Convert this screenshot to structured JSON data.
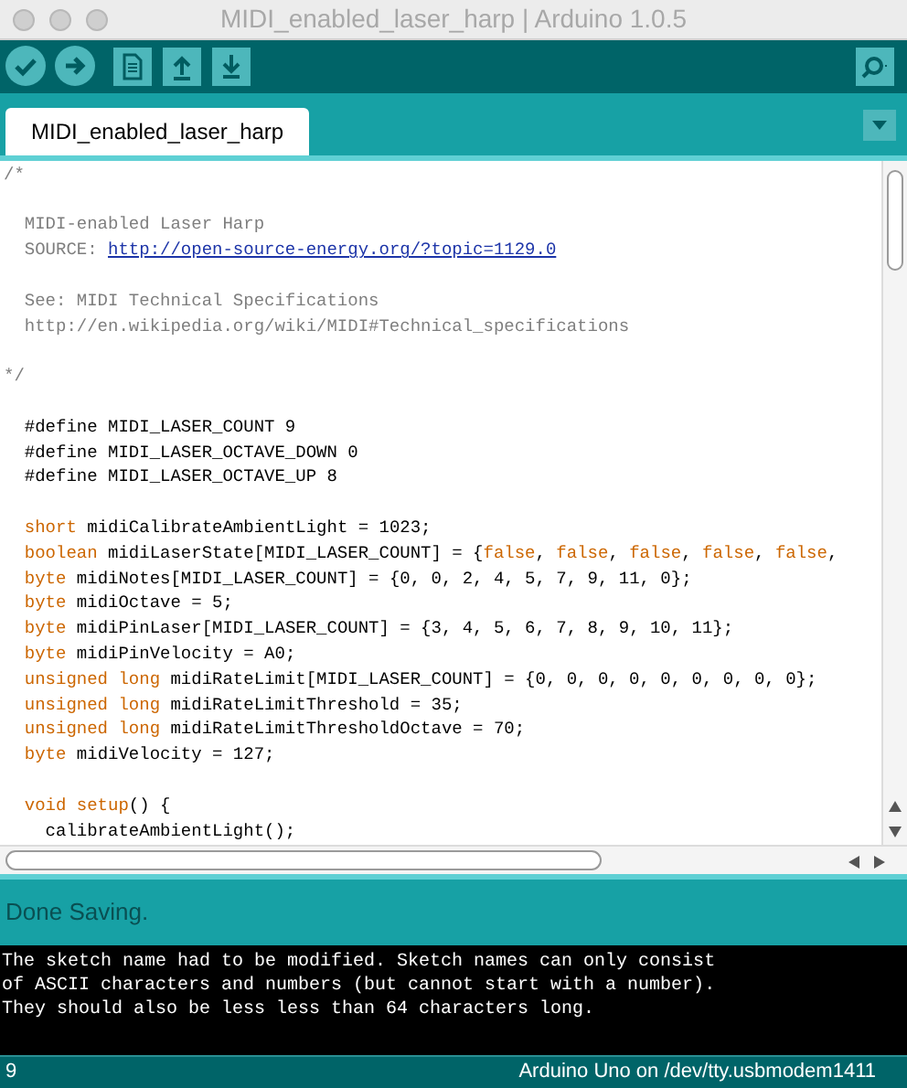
{
  "window": {
    "title": "MIDI_enabled_laser_harp | Arduino 1.0.5"
  },
  "tabs": [
    {
      "label": "MIDI_enabled_laser_harp",
      "selected": true
    }
  ],
  "editor": {
    "blocks": [
      {
        "lines": [
          [
            {
              "text": "/*",
              "kind": "comment"
            }
          ]
        ]
      },
      {
        "lines": [
          [
            {
              "text": "  MIDI-enabled Laser Harp",
              "kind": "comment"
            }
          ],
          [
            {
              "text": "  SOURCE: ",
              "kind": "comment"
            },
            {
              "text": "http://open-source-energy.org/?topic=1129.0",
              "kind": "link"
            }
          ]
        ]
      },
      {
        "lines": [
          [
            {
              "text": "  See: MIDI Technical Specifications",
              "kind": "comment"
            }
          ],
          [
            {
              "text": "  http://en.wikipedia.org/wiki/MIDI#Technical_specifications",
              "kind": "comment"
            }
          ]
        ]
      },
      {
        "lines": [
          [
            {
              "text": "*/",
              "kind": "comment"
            }
          ]
        ]
      },
      {
        "lines": [
          [
            {
              "text": "  #define MIDI_LASER_COUNT 9",
              "kind": "plain"
            }
          ],
          [
            {
              "text": "  #define MIDI_LASER_OCTAVE_DOWN 0",
              "kind": "plain"
            }
          ],
          [
            {
              "text": "  #define MIDI_LASER_OCTAVE_UP 8",
              "kind": "plain"
            }
          ]
        ]
      },
      {
        "lines": [
          [
            {
              "text": "  short",
              "kind": "keyword"
            },
            {
              "text": " midiCalibrateAmbientLight = 1023;",
              "kind": "plain"
            }
          ],
          [
            {
              "text": "  boolean",
              "kind": "keyword"
            },
            {
              "text": " midiLaserState[MIDI_LASER_COUNT] = {",
              "kind": "plain"
            },
            {
              "text": "false",
              "kind": "keyword"
            },
            {
              "text": ", ",
              "kind": "plain"
            },
            {
              "text": "false",
              "kind": "keyword"
            },
            {
              "text": ", ",
              "kind": "plain"
            },
            {
              "text": "false",
              "kind": "keyword"
            },
            {
              "text": ", ",
              "kind": "plain"
            },
            {
              "text": "false",
              "kind": "keyword"
            },
            {
              "text": ", ",
              "kind": "plain"
            },
            {
              "text": "false",
              "kind": "keyword"
            },
            {
              "text": ",",
              "kind": "plain"
            }
          ],
          [
            {
              "text": "  byte",
              "kind": "keyword"
            },
            {
              "text": " midiNotes[MIDI_LASER_COUNT] = {0, 0, 2, 4, 5, 7, 9, 11, 0};",
              "kind": "plain"
            }
          ],
          [
            {
              "text": "  byte",
              "kind": "keyword"
            },
            {
              "text": " midiOctave = 5;",
              "kind": "plain"
            }
          ],
          [
            {
              "text": "  byte",
              "kind": "keyword"
            },
            {
              "text": " midiPinLaser[MIDI_LASER_COUNT] = {3, 4, 5, 6, 7, 8, 9, 10, 11};",
              "kind": "plain"
            }
          ],
          [
            {
              "text": "  byte",
              "kind": "keyword"
            },
            {
              "text": " midiPinVelocity = A0;",
              "kind": "plain"
            }
          ],
          [
            {
              "text": "  unsigned long",
              "kind": "keyword"
            },
            {
              "text": " midiRateLimit[MIDI_LASER_COUNT] = {0, 0, 0, 0, 0, 0, 0, 0, 0};",
              "kind": "plain"
            }
          ],
          [
            {
              "text": "  unsigned long",
              "kind": "keyword"
            },
            {
              "text": " midiRateLimitThreshold = 35;",
              "kind": "plain"
            }
          ],
          [
            {
              "text": "  unsigned long",
              "kind": "keyword"
            },
            {
              "text": " midiRateLimitThresholdOctave = 70;",
              "kind": "plain"
            }
          ],
          [
            {
              "text": "  byte",
              "kind": "keyword"
            },
            {
              "text": " midiVelocity = 127;",
              "kind": "plain"
            }
          ]
        ]
      },
      {
        "lines": [
          [
            {
              "text": "  void setup",
              "kind": "keyword"
            },
            {
              "text": "() {",
              "kind": "plain"
            }
          ],
          [
            {
              "text": "    calibrateAmbientLight();",
              "kind": "plain"
            }
          ]
        ]
      }
    ]
  },
  "status": {
    "message": "Done Saving."
  },
  "console": {
    "lines": [
      "The sketch name had to be modified. Sketch names can only consist",
      "of ASCII characters and numbers (but cannot start with a number).",
      "They should also be less less than 64 characters long."
    ]
  },
  "footer": {
    "line_number": "9",
    "board": "Arduino Uno on /dev/tty.usbmodem1411"
  }
}
